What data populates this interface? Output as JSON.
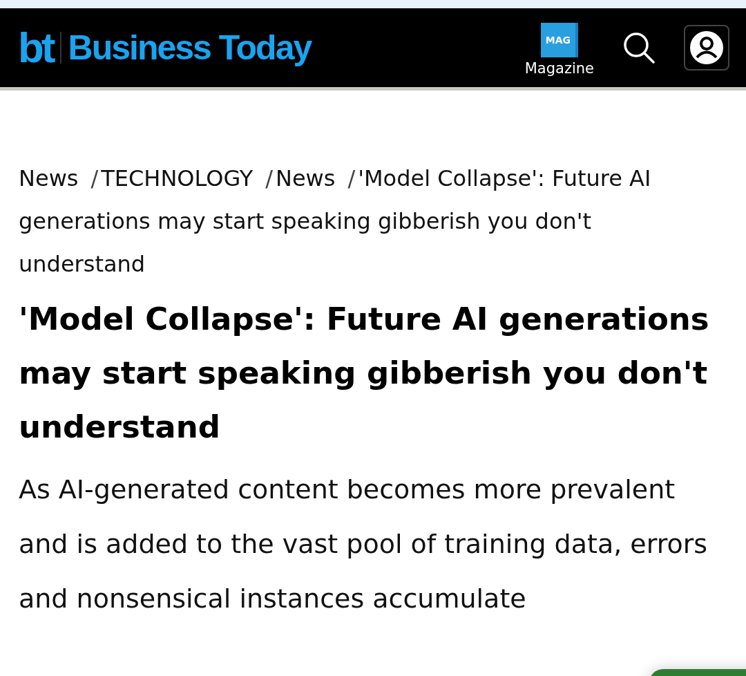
{
  "header": {
    "logo_mark": "bt",
    "logo_text": "Business Today",
    "magazine": {
      "badge": "MAG",
      "label": "Magazine"
    }
  },
  "breadcrumb": {
    "separator": "/",
    "items": [
      "News",
      "TECHNOLOGY",
      "News",
      "'Model Collapse': Future AI generations may start speaking gibberish you don't understand"
    ]
  },
  "article": {
    "title": "'Model Collapse': Future AI generations may start speaking gibberish you don't understand",
    "summary": "As AI-generated content becomes more prevalent and is added to the vast pool of training data, errors and nonsensical instances accumulate"
  }
}
